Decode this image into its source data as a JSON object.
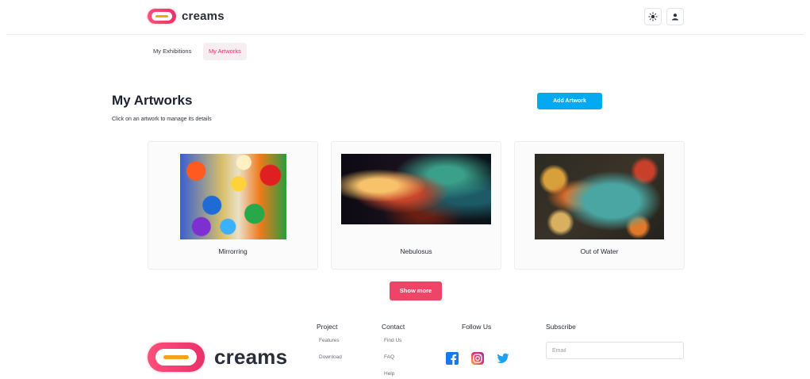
{
  "brand": {
    "name": "creams",
    "colors": {
      "primary": "#e8316a",
      "accent": "#f6a21a",
      "action": "#05a9f1"
    }
  },
  "header": {
    "theme_icon": "sun-icon",
    "user_icon": "user-icon"
  },
  "tabs": [
    {
      "label": "My Exhibitions",
      "active": false
    },
    {
      "label": "My Artworks",
      "active": true
    }
  ],
  "page": {
    "title": "My Artworks",
    "subtitle": "Click on an artwork to manage its details",
    "add_button": "Add Artwork"
  },
  "artworks": [
    {
      "title": "Mirrorring"
    },
    {
      "title": "Nebulosus"
    },
    {
      "title": "Out of Water"
    }
  ],
  "show_more": "Show more",
  "footer": {
    "project": {
      "heading": "Project",
      "links": [
        "Features",
        "Download"
      ]
    },
    "contact": {
      "heading": "Contact",
      "links": [
        "Find Us",
        "FAQ",
        "Help"
      ]
    },
    "follow": {
      "heading": "Follow Us",
      "icons": [
        "facebook-icon",
        "instagram-icon",
        "twitter-icon"
      ]
    },
    "subscribe": {
      "heading": "Subscribe",
      "email_placeholder": "Email",
      "email_value": ""
    }
  }
}
